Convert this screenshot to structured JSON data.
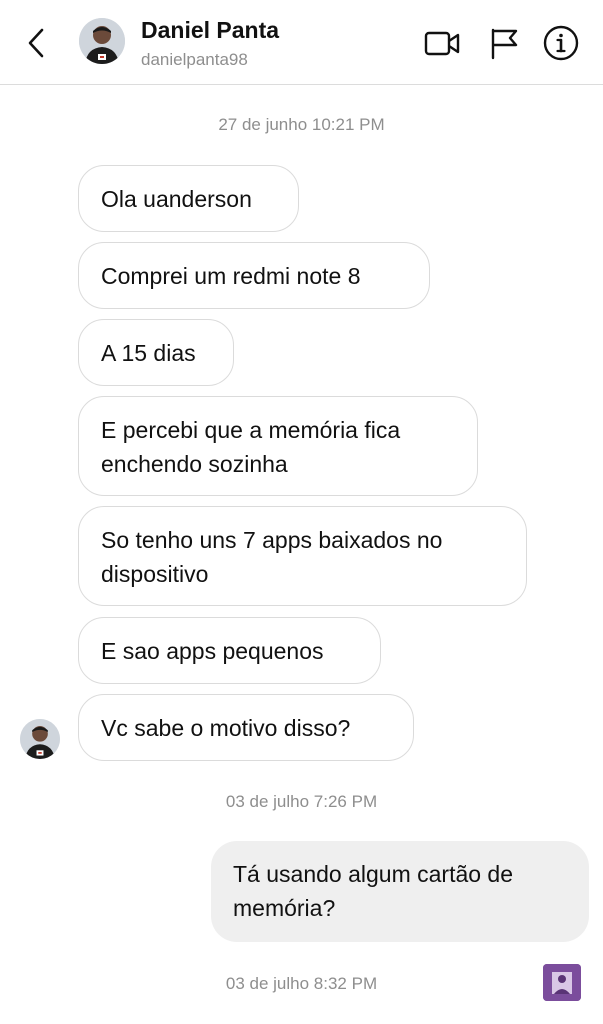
{
  "header": {
    "name": "Daniel Panta",
    "username": "danielpanta98"
  },
  "conversation": {
    "timestamps": [
      "27 de junho 10:21 PM",
      "03 de julho 7:26 PM",
      "03 de julho 8:32 PM"
    ],
    "incoming": [
      "Ola uanderson",
      "Comprei um redmi note 8",
      "A 15 dias",
      "E percebi que a memória fica enchendo sozinha",
      "So tenho uns 7 apps baixados no dispositivo",
      "E sao apps pequenos",
      "Vc sabe o motivo disso?"
    ],
    "outgoing": [
      "Tá usando algum cartão de memória?"
    ]
  },
  "icons": {
    "back": "chevron-left-icon",
    "video": "video-camera-icon",
    "flag": "flag-icon",
    "info": "info-icon"
  },
  "colors": {
    "incoming_border": "#dbdbdb",
    "outgoing_bg": "#efefef",
    "meta_text": "#8e8e8e"
  }
}
